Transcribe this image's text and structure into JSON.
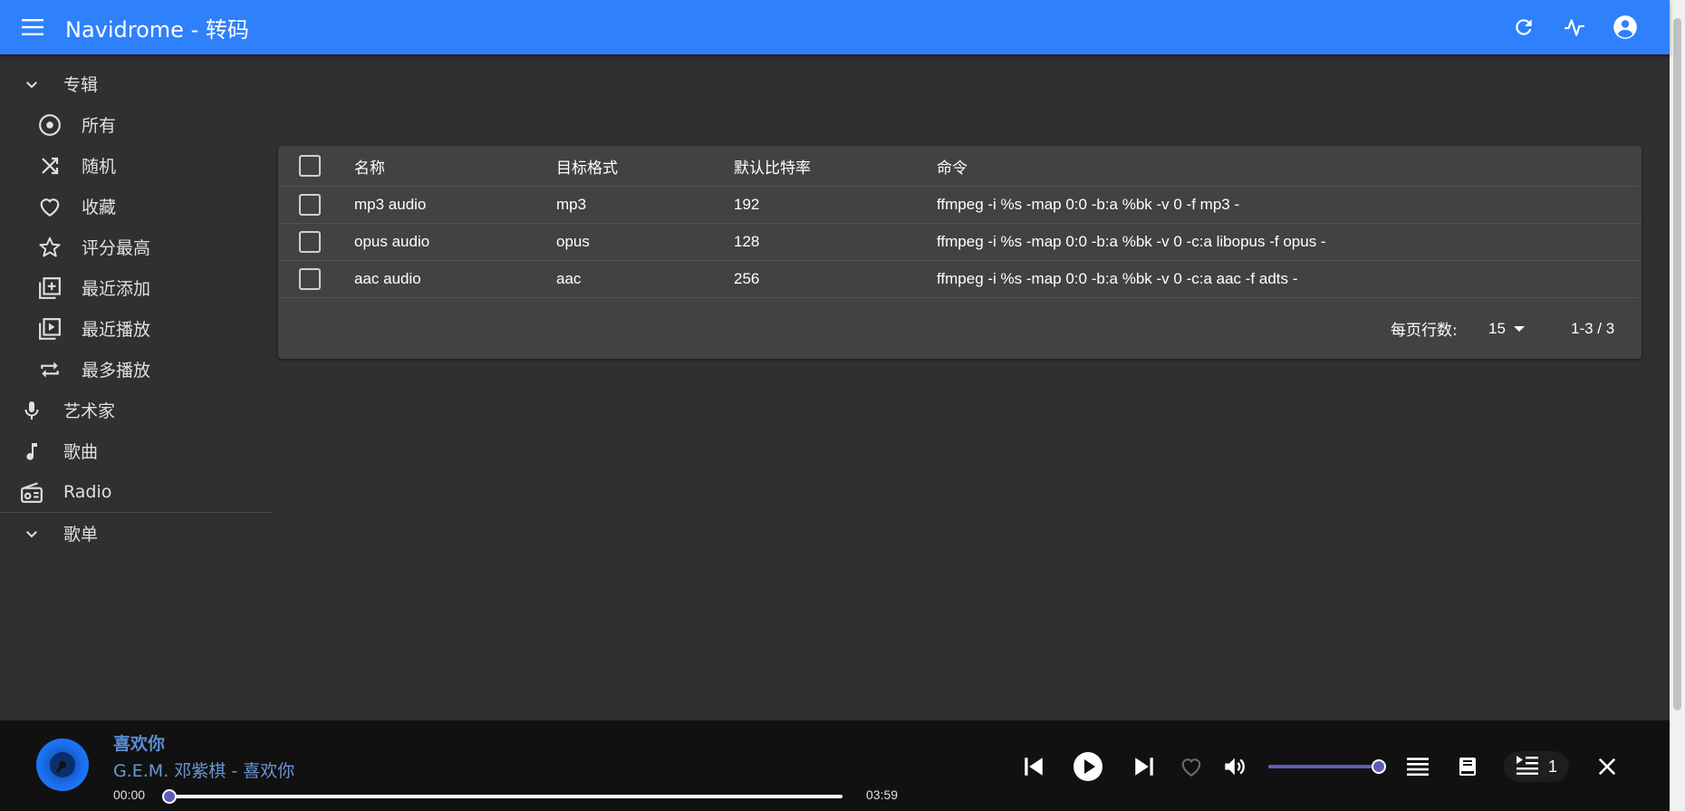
{
  "app": {
    "title": "Navidrome - 转码"
  },
  "sidebar": {
    "albums": {
      "label": "专辑",
      "items": [
        {
          "label": "所有",
          "icon": "album-icon"
        },
        {
          "label": "随机",
          "icon": "shuffle-icon"
        },
        {
          "label": "收藏",
          "icon": "heart-icon"
        },
        {
          "label": "评分最高",
          "icon": "star-icon"
        },
        {
          "label": "最近添加",
          "icon": "library-add-icon"
        },
        {
          "label": "最近播放",
          "icon": "video-library-icon"
        },
        {
          "label": "最多播放",
          "icon": "repeat-icon"
        }
      ]
    },
    "artists": {
      "label": "艺术家"
    },
    "songs": {
      "label": "歌曲"
    },
    "radio": {
      "label": "Radio"
    },
    "playlists": {
      "label": "歌单"
    }
  },
  "table": {
    "headers": {
      "name": "名称",
      "format": "目标格式",
      "bitrate": "默认比特率",
      "command": "命令"
    },
    "rows": [
      {
        "name": "mp3 audio",
        "format": "mp3",
        "bitrate": "192",
        "command": "ffmpeg -i %s -map 0:0 -b:a %bk -v 0 -f mp3 -"
      },
      {
        "name": "opus audio",
        "format": "opus",
        "bitrate": "128",
        "command": "ffmpeg -i %s -map 0:0 -b:a %bk -v 0 -c:a libopus -f opus -"
      },
      {
        "name": "aac audio",
        "format": "aac",
        "bitrate": "256",
        "command": "ffmpeg -i %s -map 0:0 -b:a %bk -v 0 -c:a aac -f adts -"
      }
    ],
    "footer": {
      "rows_per_page_label": "每页行数:",
      "rows_per_page": "15",
      "range": "1-3 / 3"
    }
  },
  "player": {
    "title": "喜欢你",
    "artist": "G.E.M. 邓紫棋 - 喜欢你",
    "current_time": "00:00",
    "total_time": "03:59",
    "progress": 0,
    "volume": 1.0,
    "queue_count": "1"
  },
  "colors": {
    "appbar": "#2f80fb",
    "background": "#303030",
    "card": "#424242",
    "accent": "#5e5eb8",
    "player": "#111111"
  }
}
